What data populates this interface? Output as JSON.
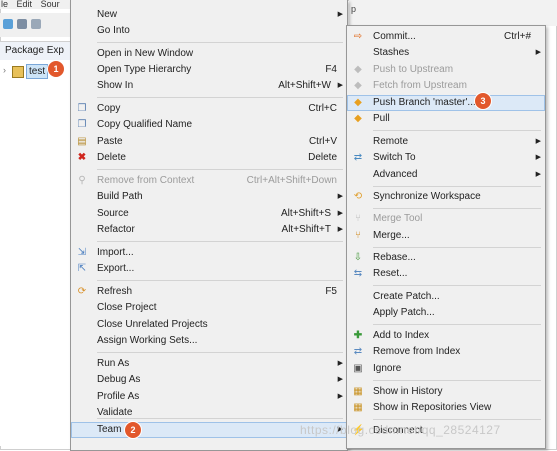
{
  "menubar": {
    "items": [
      "le",
      "Edit",
      "Sour"
    ]
  },
  "package_explorer": {
    "title": "Package Exp",
    "project_label": "test"
  },
  "right_header": {
    "label": "p"
  },
  "main_menu": {
    "items": [
      {
        "label": "New",
        "accel": "",
        "submenu": true
      },
      {
        "label": "Go Into",
        "accel": ""
      },
      {
        "label": "Open in New Window",
        "accel": ""
      },
      {
        "label": "Open Type Hierarchy",
        "accel": "F4"
      },
      {
        "label": "Show In",
        "accel": "Alt+Shift+W",
        "submenu": true
      },
      {
        "label": "Copy",
        "accel": "Ctrl+C"
      },
      {
        "label": "Copy Qualified Name",
        "accel": ""
      },
      {
        "label": "Paste",
        "accel": "Ctrl+V"
      },
      {
        "label": "Delete",
        "accel": "Delete"
      },
      {
        "label": "Remove from Context",
        "accel": "Ctrl+Alt+Shift+Down"
      },
      {
        "label": "Build Path",
        "accel": "",
        "submenu": true
      },
      {
        "label": "Source",
        "accel": "Alt+Shift+S",
        "submenu": true
      },
      {
        "label": "Refactor",
        "accel": "Alt+Shift+T",
        "submenu": true
      },
      {
        "label": "Import...",
        "accel": ""
      },
      {
        "label": "Export...",
        "accel": ""
      },
      {
        "label": "Refresh",
        "accel": "F5"
      },
      {
        "label": "Close Project",
        "accel": ""
      },
      {
        "label": "Close Unrelated Projects",
        "accel": ""
      },
      {
        "label": "Assign Working Sets...",
        "accel": ""
      },
      {
        "label": "Run As",
        "accel": "",
        "submenu": true
      },
      {
        "label": "Debug As",
        "accel": "",
        "submenu": true
      },
      {
        "label": "Profile As",
        "accel": "",
        "submenu": true
      },
      {
        "label": "Validate",
        "accel": ""
      },
      {
        "label": "Team",
        "accel": "",
        "submenu": true
      }
    ]
  },
  "team_menu": {
    "items": [
      {
        "label": "Commit...",
        "accel": "Ctrl+#"
      },
      {
        "label": "Stashes",
        "accel": "",
        "submenu": true
      },
      {
        "label": "Push to Upstream",
        "accel": ""
      },
      {
        "label": "Fetch from Upstream",
        "accel": ""
      },
      {
        "label": "Push Branch 'master'...",
        "accel": ""
      },
      {
        "label": "Pull",
        "accel": ""
      },
      {
        "label": "Remote",
        "accel": "",
        "submenu": true
      },
      {
        "label": "Switch To",
        "accel": "",
        "submenu": true
      },
      {
        "label": "Advanced",
        "accel": "",
        "submenu": true
      },
      {
        "label": "Synchronize Workspace",
        "accel": ""
      },
      {
        "label": "Merge Tool",
        "accel": ""
      },
      {
        "label": "Merge...",
        "accel": ""
      },
      {
        "label": "Rebase...",
        "accel": ""
      },
      {
        "label": "Reset...",
        "accel": ""
      },
      {
        "label": "Create Patch...",
        "accel": ""
      },
      {
        "label": "Apply Patch...",
        "accel": ""
      },
      {
        "label": "Add to Index",
        "accel": ""
      },
      {
        "label": "Remove from Index",
        "accel": ""
      },
      {
        "label": "Ignore",
        "accel": ""
      },
      {
        "label": "Show in History",
        "accel": ""
      },
      {
        "label": "Show in Repositories View",
        "accel": ""
      },
      {
        "label": "Disconnect",
        "accel": ""
      }
    ]
  },
  "badges": {
    "one": "1",
    "two": "2",
    "three": "3"
  },
  "watermark": "https://blog.csdn.net/qq_28524127",
  "colors": {
    "badge": "#e2582c",
    "hover": "#dce9f7",
    "menu_bg": "#f0f0f0"
  }
}
